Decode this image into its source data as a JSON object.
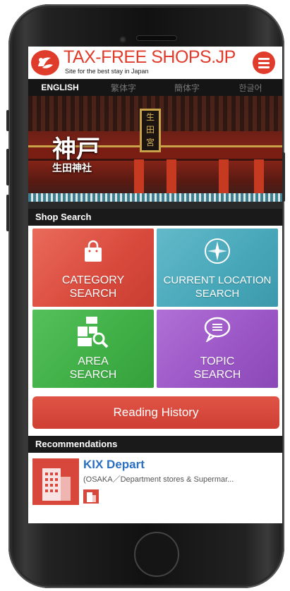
{
  "header": {
    "title": "TAX-FREE SHOPS.JP",
    "subtitle": "Site for the best stay in Japan"
  },
  "languages": [
    "ENGLISH",
    "繁体字",
    "簡体字",
    "한글어"
  ],
  "hero": {
    "title": "神戸",
    "subtitle": "生田神社",
    "plaque_chars": [
      "生",
      "田",
      "宮"
    ]
  },
  "shop_search": {
    "heading": "Shop Search",
    "tiles": [
      {
        "line1": "CATEGORY",
        "line2": "SEARCH",
        "icon": "shopping-bag-icon",
        "color": "#d8493c"
      },
      {
        "line1": "CURRENT LOCATION",
        "line2": "SEARCH",
        "icon": "compass-icon",
        "color": "#47a7b9"
      },
      {
        "line1": "AREA",
        "line2": "SEARCH",
        "icon": "area-map-search-icon",
        "color": "#3fae45"
      },
      {
        "line1": "TOPIC",
        "line2": "SEARCH",
        "icon": "speech-bubble-icon",
        "color": "#9a55c5"
      }
    ]
  },
  "reading_history": {
    "label": "Reading History"
  },
  "recommendations": {
    "heading": "Recommendations",
    "items": [
      {
        "name": "KIX Depart",
        "description": "(OSAKA／Department stores & Supermar..."
      }
    ]
  },
  "colors": {
    "accent": "#e03c2c",
    "dark_bar": "#1a1a1a",
    "link": "#2a6fc0"
  }
}
